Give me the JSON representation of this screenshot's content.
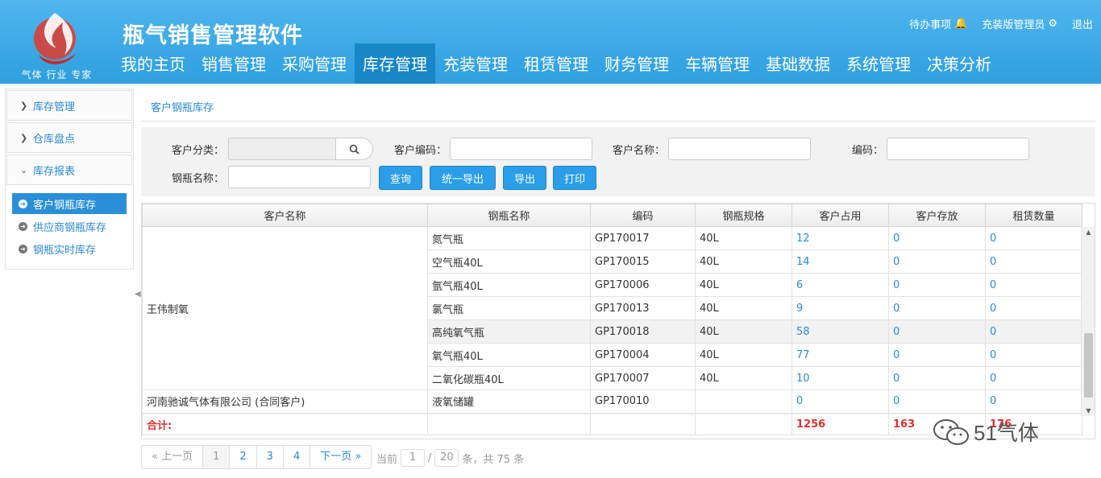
{
  "header": {
    "title": "瓶气销售管理软件",
    "slogan": "气体 行业 专家",
    "todo": "待办事项",
    "admin": "充装版管理员",
    "logout": "退出",
    "nav": [
      "我的主页",
      "销售管理",
      "采购管理",
      "库存管理",
      "充装管理",
      "租赁管理",
      "财务管理",
      "车辆管理",
      "基础数据",
      "系统管理",
      "决策分析"
    ],
    "nav_active": "库存管理"
  },
  "sidebar": {
    "groups": [
      {
        "label": "库存管理",
        "expanded": false
      },
      {
        "label": "仓库盘点",
        "expanded": false
      },
      {
        "label": "库存报表",
        "expanded": true
      }
    ],
    "subitems": [
      {
        "label": "客户钢瓶库存",
        "active": true
      },
      {
        "label": "供应商钢瓶库存",
        "active": false
      },
      {
        "label": "钢瓶实时库存",
        "active": false
      }
    ]
  },
  "breadcrumb": "客户钢瓶库存",
  "filter": {
    "customer_category_label": "客户分类：",
    "customer_code_label": "客户编码：",
    "customer_name_label": "客户名称：",
    "code_label": "编码：",
    "cylinder_name_label": "钢瓶名称：",
    "btn_query": "查询",
    "btn_export_all": "统一导出",
    "btn_export": "导出",
    "btn_print": "打印"
  },
  "table": {
    "columns": [
      "客户名称",
      "钢瓶名称",
      "编码",
      "钢瓶规格",
      "客户占用",
      "客户存放",
      "租赁数量"
    ],
    "group1_customer": "王伟制氧",
    "group1_rows": [
      {
        "name": "氮气瓶",
        "code": "GP170017",
        "spec": "40L",
        "occupy": "12",
        "stored": "0",
        "lease": "0"
      },
      {
        "name": "空气瓶40L",
        "code": "GP170015",
        "spec": "40L",
        "occupy": "14",
        "stored": "0",
        "lease": "0"
      },
      {
        "name": "氩气瓶40L",
        "code": "GP170006",
        "spec": "40L",
        "occupy": "6",
        "stored": "0",
        "lease": "0"
      },
      {
        "name": "氯气瓶",
        "code": "GP170013",
        "spec": "40L",
        "occupy": "9",
        "stored": "0",
        "lease": "0"
      },
      {
        "name": "高纯氧气瓶",
        "code": "GP170018",
        "spec": "40L",
        "occupy": "58",
        "stored": "0",
        "lease": "0"
      },
      {
        "name": "氧气瓶40L",
        "code": "GP170004",
        "spec": "40L",
        "occupy": "77",
        "stored": "0",
        "lease": "0"
      },
      {
        "name": "二氧化碳瓶40L",
        "code": "GP170007",
        "spec": "40L",
        "occupy": "10",
        "stored": "0",
        "lease": "0"
      }
    ],
    "group2_customer": "河南驰诚气体有限公司 (合同客户)",
    "group2_row": {
      "name": "液氧储罐",
      "code": "GP170010",
      "spec": "",
      "occupy": "0",
      "stored": "0",
      "lease": "0"
    },
    "total": {
      "label": "合计:",
      "occupy": "1256",
      "stored": "163",
      "lease": "176"
    }
  },
  "pager": {
    "prev": "« 上一页",
    "pages": [
      "1",
      "2",
      "3",
      "4"
    ],
    "next": "下一页 »",
    "current_label": "当前",
    "current": "1",
    "slash": "/",
    "per_page": "20",
    "suffix": "条，共 75 条"
  },
  "watermark": "51气体"
}
